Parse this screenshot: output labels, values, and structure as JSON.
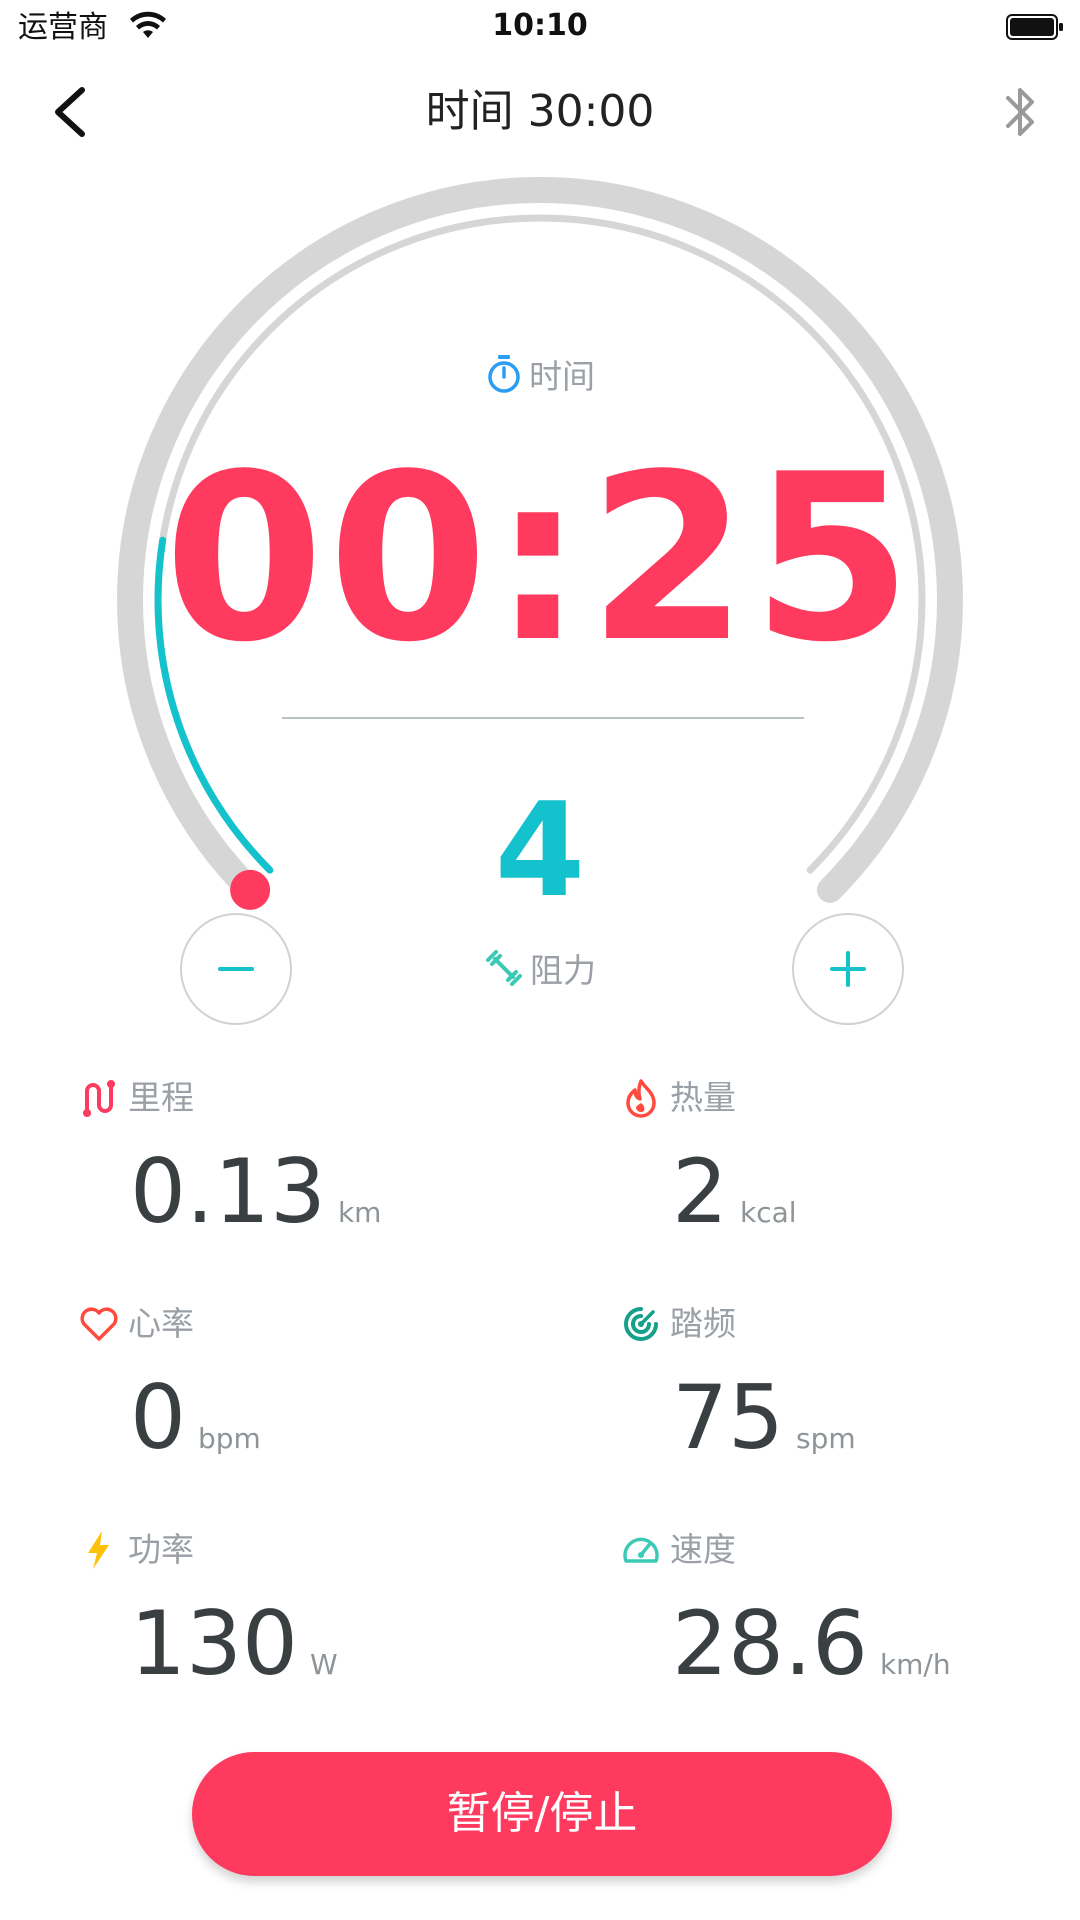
{
  "status_bar": {
    "carrier": "运营商",
    "time": "10:10"
  },
  "nav": {
    "title": "时间 30:00"
  },
  "workout": {
    "time_label": "时间",
    "time_value": "00:25",
    "progress_fraction": 0.2,
    "resistance_value": "4",
    "resistance_label": "阻力",
    "minus_symbol": "−",
    "plus_symbol": "+"
  },
  "stats": {
    "distance": {
      "label": "里程",
      "value": "0.13",
      "unit": "km",
      "icon": "route-icon",
      "color": "#ff3a5f"
    },
    "calories": {
      "label": "热量",
      "value": "2",
      "unit": "kcal",
      "icon": "flame-icon",
      "color": "#ff4a3d"
    },
    "heart_rate": {
      "label": "心率",
      "value": "0",
      "unit": "bpm",
      "icon": "heart-icon",
      "color": "#ff4a3d"
    },
    "cadence": {
      "label": "踏频",
      "value": "75",
      "unit": "spm",
      "icon": "cadence-icon",
      "color": "#14a08a"
    },
    "power": {
      "label": "功率",
      "value": "130",
      "unit": "W",
      "icon": "lightning-icon",
      "color": "#ffc107"
    },
    "speed": {
      "label": "速度",
      "value": "28.6",
      "unit": "km/h",
      "icon": "speedometer-icon",
      "color": "#3cc9b5"
    }
  },
  "actions": {
    "pause_stop_label": "暂停/停止"
  },
  "colors": {
    "accent_red": "#ff3a5f",
    "accent_cyan": "#13c2cc",
    "track_gray": "#d6d6d6"
  }
}
